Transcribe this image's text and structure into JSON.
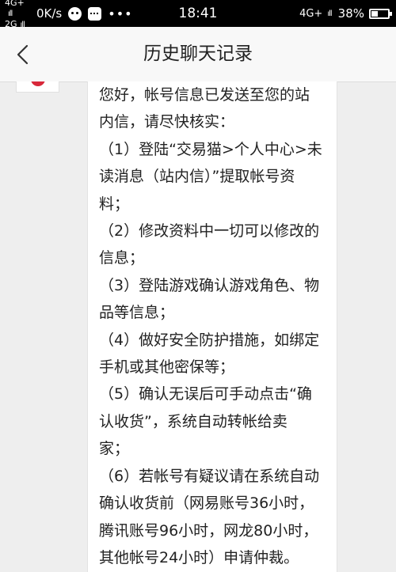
{
  "status_bar": {
    "network_top": "4G+",
    "network_bottom": "2G",
    "signal_top": "ıll",
    "signal_bottom": "ıll",
    "speed": "0K/s",
    "more": "•••",
    "time": "18:41",
    "network_right": "4G+",
    "signal_right": "ıll",
    "battery_percent": "38%",
    "battery_level": 0.38,
    "icons": [
      "wechat-icon",
      "message-icon"
    ]
  },
  "header": {
    "title": "历史聊天记录",
    "back_icon": "chevron-left-icon"
  },
  "chat": {
    "message_lines": [
      "您好，帐号信息已发送至您的站",
      "内信，请尽快核实：",
      "（1）登陆“交易猫>个人中心>未",
      "读消息（站内信）”提取帐号资",
      "料；",
      "（2）修改资料中一切可以修改的",
      "信息；",
      "（3）登陆游戏确认游戏角色、物",
      "品等信息；",
      "（4）做好安全防护措施，如绑定",
      "手机或其他密保等；",
      "（5）确认无误后可手动点击“确",
      "认收货”，系统自动转帐给卖",
      "家；",
      "（6）若帐号有疑议请在系统自动",
      "确认收货前（网易账号36小时，",
      "腾讯账号96小时，网龙80小时，",
      "其他帐号24小时）申请仲裁。"
    ]
  },
  "colors": {
    "status_bar_bg": "#000000",
    "header_bg": "#f8f8f8",
    "page_bg": "#eeeeee",
    "bubble_bg": "#ffffff",
    "avatar_accent": "#d8283a"
  }
}
